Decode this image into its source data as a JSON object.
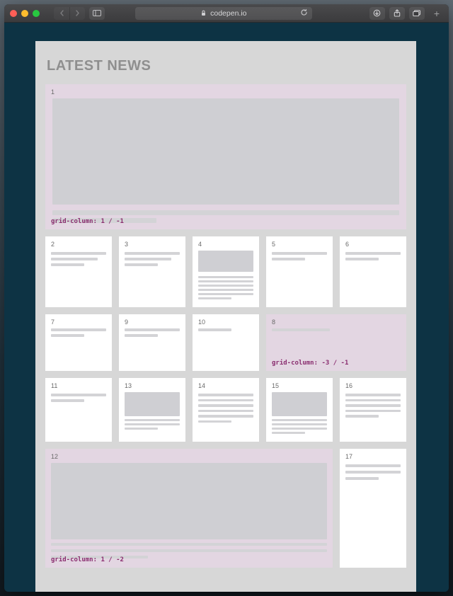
{
  "browser": {
    "url_host": "codepen.io",
    "lock_label": "Secure"
  },
  "page": {
    "title": "LATEST NEWS"
  },
  "cards": {
    "c1": {
      "n": "1",
      "code": "grid-column: 1 / -1"
    },
    "c2": {
      "n": "2"
    },
    "c3": {
      "n": "3"
    },
    "c4": {
      "n": "4"
    },
    "c5": {
      "n": "5"
    },
    "c6": {
      "n": "6"
    },
    "c7": {
      "n": "7"
    },
    "c9": {
      "n": "9"
    },
    "c10": {
      "n": "10"
    },
    "c8": {
      "n": "8",
      "code": "grid-column: -3 / -1"
    },
    "c11": {
      "n": "11"
    },
    "c13": {
      "n": "13"
    },
    "c14": {
      "n": "14"
    },
    "c15": {
      "n": "15"
    },
    "c16": {
      "n": "16"
    },
    "c12": {
      "n": "12",
      "code": "grid-column: 1 / -2"
    },
    "c17": {
      "n": "17"
    }
  }
}
